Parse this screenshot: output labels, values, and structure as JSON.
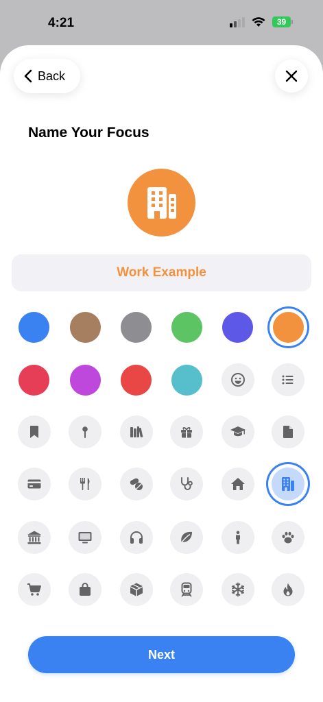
{
  "status_bar": {
    "time": "4:21",
    "battery": "39",
    "battery_color": "#34c759"
  },
  "header": {
    "back_label": "Back",
    "back_icon": "chevron-left-icon",
    "close_icon": "close-icon"
  },
  "title": "Name Your Focus",
  "focus": {
    "icon": "building-icon",
    "color": "#f2923e",
    "name": "Work Example"
  },
  "colors": [
    {
      "name": "blue",
      "hex": "#3a82f2",
      "selected": false
    },
    {
      "name": "brown",
      "hex": "#a67f61",
      "selected": false
    },
    {
      "name": "gray",
      "hex": "#8d8d92",
      "selected": false
    },
    {
      "name": "green",
      "hex": "#5dc464",
      "selected": false
    },
    {
      "name": "indigo",
      "hex": "#5e58e7",
      "selected": false
    },
    {
      "name": "orange",
      "hex": "#f2923e",
      "selected": true
    },
    {
      "name": "red",
      "hex": "#e73e57",
      "selected": false
    },
    {
      "name": "purple",
      "hex": "#be48dc",
      "selected": false
    },
    {
      "name": "red-orange",
      "hex": "#e84746",
      "selected": false
    },
    {
      "name": "teal",
      "hex": "#56bfcb",
      "selected": false
    }
  ],
  "icons": [
    {
      "name": "smiley-icon",
      "selected": false
    },
    {
      "name": "list-icon",
      "selected": false
    },
    {
      "name": "bookmark-icon",
      "selected": false
    },
    {
      "name": "pin-icon",
      "selected": false
    },
    {
      "name": "books-icon",
      "selected": false
    },
    {
      "name": "gift-icon",
      "selected": false
    },
    {
      "name": "graduation-cap-icon",
      "selected": false
    },
    {
      "name": "document-icon",
      "selected": false
    },
    {
      "name": "credit-card-icon",
      "selected": false
    },
    {
      "name": "fork-knife-icon",
      "selected": false
    },
    {
      "name": "pills-icon",
      "selected": false
    },
    {
      "name": "stethoscope-icon",
      "selected": false
    },
    {
      "name": "house-icon",
      "selected": false
    },
    {
      "name": "building-icon",
      "selected": true
    },
    {
      "name": "bank-icon",
      "selected": false
    },
    {
      "name": "monitor-icon",
      "selected": false
    },
    {
      "name": "headphones-icon",
      "selected": false
    },
    {
      "name": "leaf-icon",
      "selected": false
    },
    {
      "name": "person-icon",
      "selected": false
    },
    {
      "name": "paw-icon",
      "selected": false
    },
    {
      "name": "cart-icon",
      "selected": false
    },
    {
      "name": "bag-icon",
      "selected": false
    },
    {
      "name": "box-icon",
      "selected": false
    },
    {
      "name": "train-icon",
      "selected": false
    },
    {
      "name": "snowflake-icon",
      "selected": false
    },
    {
      "name": "flame-icon",
      "selected": false
    }
  ],
  "next_label": "Next"
}
